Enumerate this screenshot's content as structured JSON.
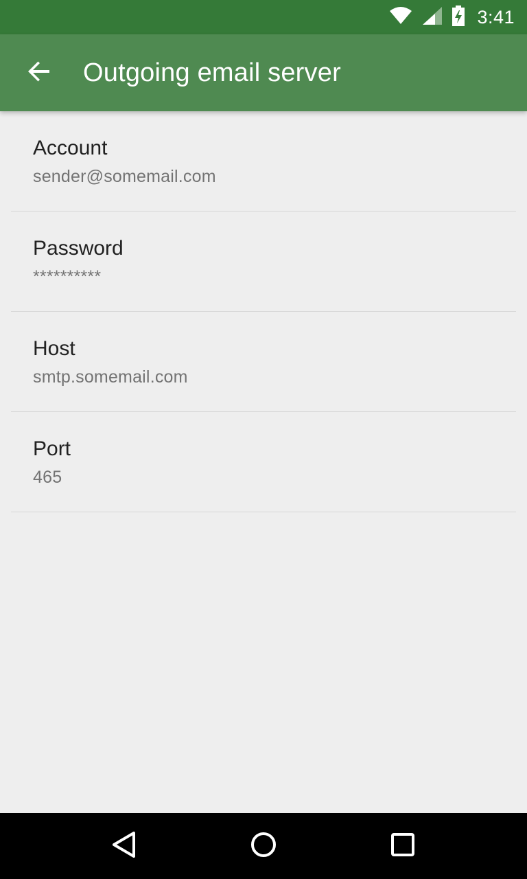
{
  "status_bar": {
    "time": "3:41",
    "icons": [
      "wifi-icon",
      "cell-signal-icon",
      "battery-charging-icon"
    ]
  },
  "app_bar": {
    "back_icon": "arrow-back-icon",
    "title": "Outgoing email server",
    "color": "#4f8a51"
  },
  "settings": [
    {
      "title": "Account",
      "summary": "sender@somemail.com"
    },
    {
      "title": "Password",
      "summary": "**********"
    },
    {
      "title": "Host",
      "summary": "smtp.somemail.com"
    },
    {
      "title": "Port",
      "summary": "465"
    }
  ],
  "nav_bar": {
    "buttons": [
      "back-triangle-icon",
      "home-circle-icon",
      "recents-square-icon"
    ]
  },
  "colors": {
    "status_bar": "#357a38",
    "app_bar": "#4f8a51",
    "background": "#eeeeee"
  }
}
